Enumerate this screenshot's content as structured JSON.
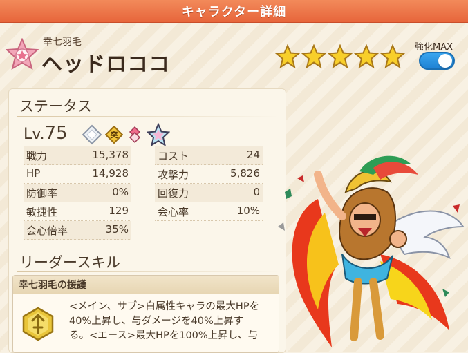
{
  "screen_title": "キャラクター詳細",
  "character": {
    "subtitle": "幸七羽毛",
    "name": "ヘッドロココ",
    "stars": 5,
    "max_label": "強化MAX",
    "max_enabled": true
  },
  "status": {
    "section_title": "ステータス",
    "level_label": "Lv.",
    "level_value": "75",
    "gem_badge": "突",
    "left_stats": [
      {
        "label": "戦力",
        "value": "15,378"
      },
      {
        "label": "HP",
        "value": "14,928"
      },
      {
        "label": "防御率",
        "value": "0%"
      },
      {
        "label": "敏捷性",
        "value": "129"
      },
      {
        "label": "会心倍率",
        "value": "35%"
      }
    ],
    "right_stats": [
      {
        "label": "コスト",
        "value": "24"
      },
      {
        "label": "攻撃力",
        "value": "5,826"
      },
      {
        "label": "回復力",
        "value": "0"
      },
      {
        "label": "会心率",
        "value": "10%"
      }
    ]
  },
  "leader_skill": {
    "section_title": "リーダースキル",
    "name": "幸七羽毛の援護",
    "line1": "<メイン、サブ>白属性キャラの最大HPを",
    "line2": "40%上昇し、与ダメージを40%上昇す",
    "line3": "る。<エース>最大HPを100%上昇し、与"
  },
  "colors": {
    "title_bar": "#e7653b",
    "star": "#f5c518",
    "toggle": "#1f82d4"
  }
}
